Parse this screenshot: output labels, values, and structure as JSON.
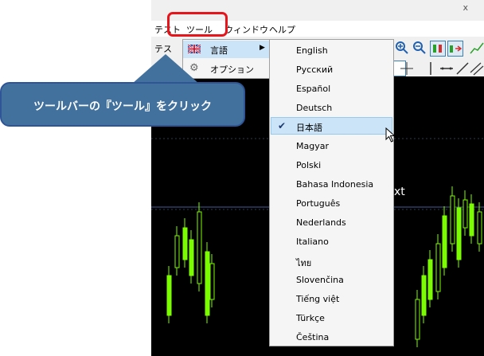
{
  "app": {
    "close_glyph": "x",
    "menubar": {
      "items": [
        {
          "label": "テスト"
        },
        {
          "label": "ツール"
        },
        {
          "label": "ウィンドウ"
        },
        {
          "label": "ヘルプ"
        }
      ]
    },
    "toolbar": {
      "partial_label": "テス"
    }
  },
  "tools_menu": {
    "items": [
      {
        "label": "言語",
        "icon": "uk-flag-icon",
        "has_submenu": true
      },
      {
        "label": "オプション",
        "icon": "options-icon",
        "has_submenu": false
      }
    ]
  },
  "language_menu": {
    "items": [
      {
        "label": "English"
      },
      {
        "label": "Русский"
      },
      {
        "label": "Español"
      },
      {
        "label": "Deutsch"
      },
      {
        "label": "日本語",
        "checked": true
      },
      {
        "label": "Magyar"
      },
      {
        "label": "Polski"
      },
      {
        "label": "Bahasa Indonesia"
      },
      {
        "label": "Português"
      },
      {
        "label": "Nederlands"
      },
      {
        "label": "Italiano"
      },
      {
        "label": "ไทย"
      },
      {
        "label": "Slovenčina"
      },
      {
        "label": "Tiếng việt"
      },
      {
        "label": "Türkçe"
      },
      {
        "label": "Čeština"
      }
    ],
    "check_glyph": "✔"
  },
  "chart": {
    "partial_text": "xt"
  },
  "callout": {
    "text": "ツールバーの『ツール』をクリック"
  },
  "colors": {
    "highlight": "#e8141b",
    "callout_bg": "#41719c",
    "selected_bg": "#cce4f7",
    "chart_bg": "#000000",
    "candle": "#7cfc00"
  }
}
